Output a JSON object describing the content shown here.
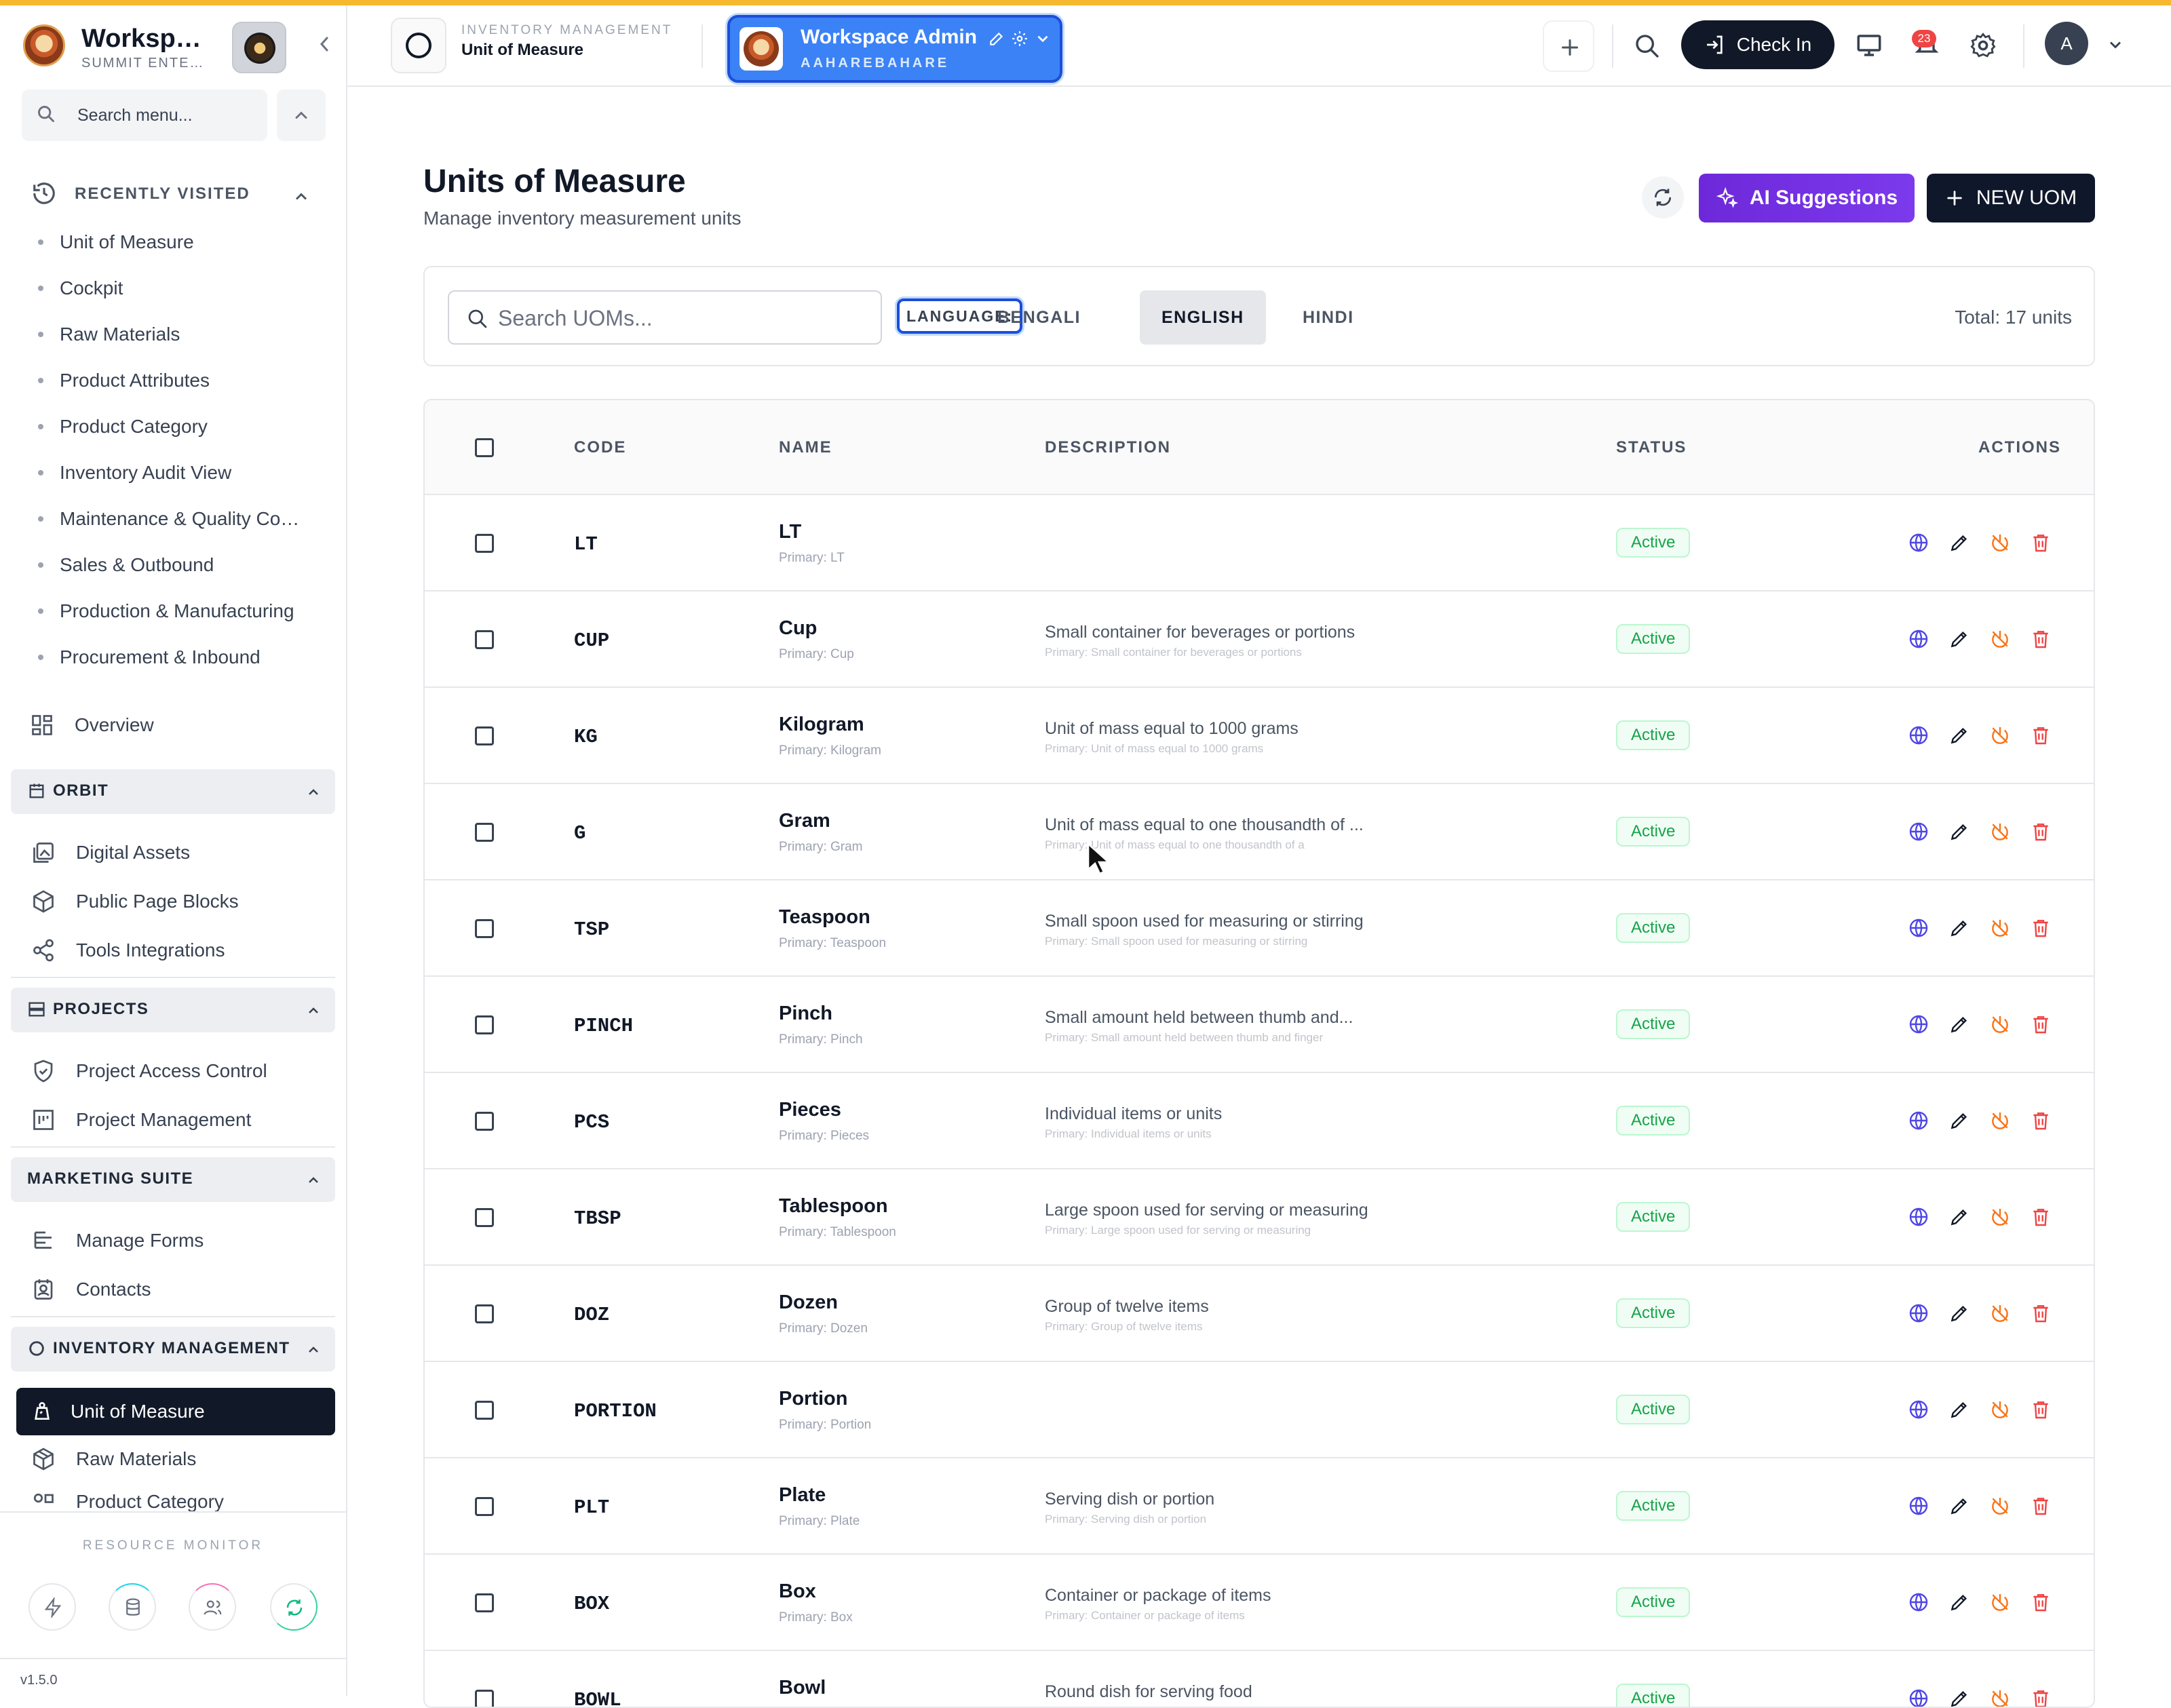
{
  "sidebar": {
    "workspace_name": "Worksp…",
    "workspace_sub": "SUMMIT ENTE…",
    "search_placeholder": "Search menu...",
    "recent_title": "RECENTLY VISITED",
    "recent": [
      "Unit of Measure",
      "Cockpit",
      "Raw Materials",
      "Product Attributes",
      "Product Category",
      "Inventory Audit View",
      "Maintenance & Quality Co…",
      "Sales & Outbound",
      "Production & Manufacturing",
      "Procurement & Inbound"
    ],
    "overview": "Overview",
    "orbit": {
      "title": "ORBIT",
      "items": [
        "Digital Assets",
        "Public Page Blocks",
        "Tools Integrations"
      ]
    },
    "projects": {
      "title": "PROJECTS",
      "items": [
        "Project Access Control",
        "Project Management"
      ]
    },
    "marketing": {
      "title": "MARKETING SUITE",
      "items": [
        "Manage Forms",
        "Contacts"
      ]
    },
    "inventory": {
      "title": "INVENTORY MANAGEMENT",
      "items": [
        "Unit of Measure",
        "Raw Materials",
        "Product Category"
      ]
    },
    "resource_title": "RESOURCE MONITOR",
    "version": "v1.5.0"
  },
  "header": {
    "module_sub": "INVENTORY MANAGEMENT",
    "module_title": "Unit of Measure",
    "ws_title": "Workspace Admin",
    "ws_sub": "AAHAREBAHARE",
    "checkin": "Check In",
    "notif_count": "23",
    "avatar": "A"
  },
  "page": {
    "title": "Units of Measure",
    "subtitle": "Manage inventory measurement units",
    "ai_label": "AI Suggestions",
    "new_label": "NEW UOM",
    "search_placeholder": "Search UOMs...",
    "language_label": "LANGUAGE:",
    "languages": [
      "BENGALI",
      "ENGLISH",
      "HINDI"
    ],
    "active_language": "ENGLISH",
    "total": "Total: 17 units"
  },
  "table": {
    "headers": [
      "CODE",
      "NAME",
      "DESCRIPTION",
      "STATUS",
      "ACTIONS"
    ],
    "rows": [
      {
        "code": "LT",
        "name": "LT",
        "primary": "Primary: LT",
        "desc": "",
        "desc_p": "",
        "status": "Active"
      },
      {
        "code": "CUP",
        "name": "Cup",
        "primary": "Primary: Cup",
        "desc": "Small container for beverages or portions",
        "desc_p": "Primary: Small container for beverages or portions",
        "status": "Active"
      },
      {
        "code": "KG",
        "name": "Kilogram",
        "primary": "Primary: Kilogram",
        "desc": "Unit of mass equal to 1000 grams",
        "desc_p": "Primary: Unit of mass equal to 1000 grams",
        "status": "Active"
      },
      {
        "code": "G",
        "name": "Gram",
        "primary": "Primary: Gram",
        "desc": "Unit of mass equal to one thousandth of ...",
        "desc_p": "Primary: Unit of mass equal to one thousandth of a",
        "status": "Active"
      },
      {
        "code": "TSP",
        "name": "Teaspoon",
        "primary": "Primary: Teaspoon",
        "desc": "Small spoon used for measuring or stirring",
        "desc_p": "Primary: Small spoon used for measuring or stirring",
        "status": "Active"
      },
      {
        "code": "PINCH",
        "name": "Pinch",
        "primary": "Primary: Pinch",
        "desc": "Small amount held between thumb and...",
        "desc_p": "Primary: Small amount held between thumb and finger",
        "status": "Active"
      },
      {
        "code": "PCS",
        "name": "Pieces",
        "primary": "Primary: Pieces",
        "desc": "Individual items or units",
        "desc_p": "Primary: Individual items or units",
        "status": "Active"
      },
      {
        "code": "TBSP",
        "name": "Tablespoon",
        "primary": "Primary: Tablespoon",
        "desc": "Large spoon used for serving or measuring",
        "desc_p": "Primary: Large spoon used for serving or measuring",
        "status": "Active"
      },
      {
        "code": "DOZ",
        "name": "Dozen",
        "primary": "Primary: Dozen",
        "desc": "Group of twelve items",
        "desc_p": "Primary: Group of twelve items",
        "status": "Active"
      },
      {
        "code": "PORTION",
        "name": "Portion",
        "primary": "Primary: Portion",
        "desc": "",
        "desc_p": "",
        "status": "Active"
      },
      {
        "code": "PLT",
        "name": "Plate",
        "primary": "Primary: Plate",
        "desc": "Serving dish or portion",
        "desc_p": "Primary: Serving dish or portion",
        "status": "Active"
      },
      {
        "code": "BOX",
        "name": "Box",
        "primary": "Primary: Box",
        "desc": "Container or package of items",
        "desc_p": "Primary: Container or package of items",
        "status": "Active"
      },
      {
        "code": "BOWL",
        "name": "Bowl",
        "primary": "",
        "desc": "Round dish for serving food",
        "desc_p": "",
        "status": "Active"
      }
    ]
  },
  "colors": {
    "accent": "#3b82f6",
    "topline": "#f5b82e",
    "active_status": "#16a34a",
    "delete": "#ef4444",
    "deactivate": "#f97316",
    "ai": "#7c3aed"
  },
  "icons": [
    "search-icon",
    "history-icon",
    "grid-icon",
    "calendar-icon",
    "image-icon",
    "cube-icon",
    "share-icon",
    "shield-icon",
    "chart-icon",
    "form-icon",
    "contact-icon",
    "scale-icon",
    "box-icon",
    "refresh-icon",
    "sparkles-icon",
    "plus-icon",
    "monitor-icon",
    "bell-icon",
    "gear-icon",
    "globe-icon",
    "pencil-icon",
    "power-off-icon",
    "trash-icon"
  ]
}
